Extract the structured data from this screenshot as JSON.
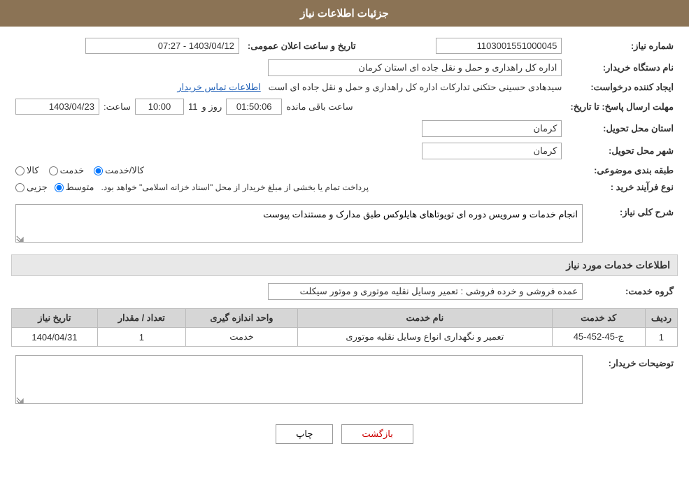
{
  "header": {
    "title": "جزئیات اطلاعات نیاز"
  },
  "fields": {
    "shomara_niaz_label": "شماره نیاز:",
    "shomara_niaz_value": "1103001551000045",
    "nam_dastgah_label": "نام دستگاه خریدار:",
    "nam_dastgah_value": "اداره کل راهداری و حمل و نقل جاده ای استان کرمان",
    "ijad_konande_label": "ایجاد کننده درخواست:",
    "ijad_konande_value": "سیدهادی حسینی حتکنی تدارکات اداره کل راهداری و حمل و نقل جاده ای است",
    "mohlat_ersal_label": "مهلت ارسال پاسخ: تا تاریخ:",
    "date_value": "1403/04/23",
    "time_label": "ساعت:",
    "time_value": "10:00",
    "roz_label": "روز و",
    "roz_value": "11",
    "baqi_label": "ساعت باقی مانده",
    "baqi_value": "01:50:06",
    "ostan_tahvil_label": "استان محل تحویل:",
    "ostan_tahvil_value": "کرمان",
    "shahr_tahvil_label": "شهر محل تحویل:",
    "shahr_tahvil_value": "کرمان",
    "tabaqe_label": "طبقه بندی موضوعی:",
    "kala_label": "کالا",
    "khedmat_label": "خدمت",
    "kala_khedmat_label": "کالا/خدمت",
    "nav_farayand_label": "نوع فرآیند خرید :",
    "jozii_label": "جزیی",
    "motavasset_label": "متوسط",
    "nav_farayand_note": "پرداخت تمام یا بخشی از مبلغ خریدار از محل \"اسناد خزانه اسلامی\" خواهد بود.",
    "contact_link": "اطلاعات تماس خریدار",
    "tarikh_va_saat_label": "تاریخ و ساعت اعلان عمومی:",
    "tarikh_va_saat_value": "1403/04/12 - 07:27"
  },
  "sharh": {
    "section_title": "شرح کلی نیاز:",
    "content": "انجام خدمات و سرویس دوره ای تویوتاهای هایلوکس طبق مدارک و مستندات پیوست"
  },
  "khadamat_section": {
    "title": "اطلاعات خدمات مورد نیاز",
    "goroh_label": "گروه خدمت:",
    "goroh_value": "عمده فروشی و خرده فروشی : تعمیر وسایل نقلیه موتوری و موتور سیکلت"
  },
  "table": {
    "col_radif": "ردیف",
    "col_code": "کد خدمت",
    "col_name": "نام خدمت",
    "col_vahed": "واحد اندازه گیری",
    "col_tedad": "تعداد / مقدار",
    "col_tarikh": "تاریخ نیاز",
    "rows": [
      {
        "radif": "1",
        "code": "ج-45-452-45",
        "name": "تعمیر و نگهداری انواع وسایل نقلیه موتوری",
        "vahed": "خدمت",
        "tedad": "1",
        "tarikh": "1404/04/31"
      }
    ]
  },
  "tawzih": {
    "label": "توضیحات خریدار:",
    "value": ""
  },
  "buttons": {
    "print": "چاپ",
    "back": "بازگشت"
  }
}
